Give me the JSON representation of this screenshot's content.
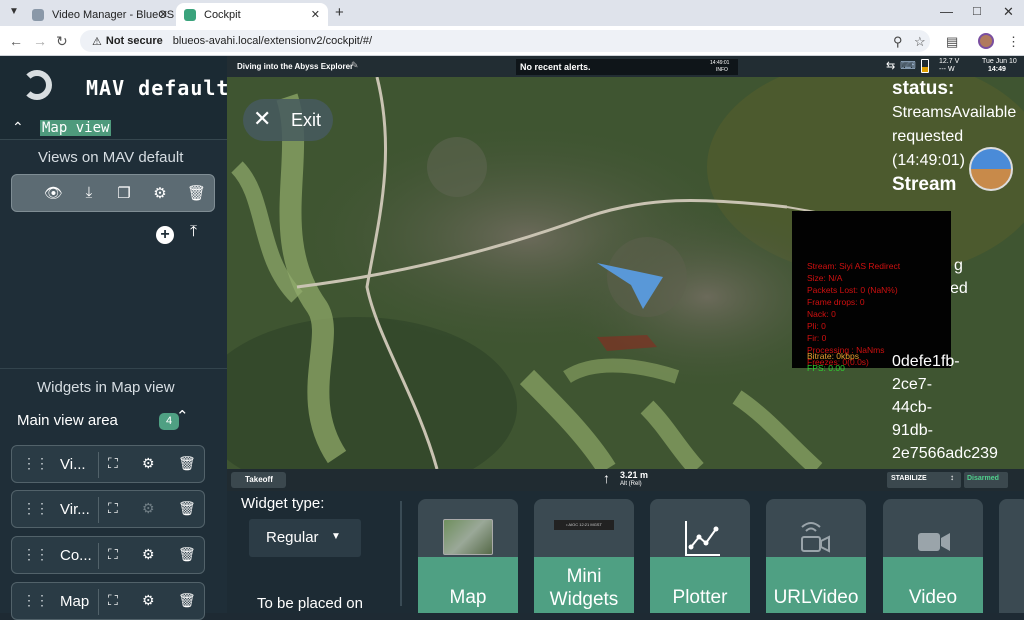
{
  "browser": {
    "tabs": [
      {
        "title": "Video Manager - BlueOS",
        "active": false
      },
      {
        "title": "Cockpit",
        "active": true
      }
    ],
    "not_secure_label": "Not secure",
    "url": "blueos-avahi.local/extensionv2/cockpit/#/"
  },
  "sidebar": {
    "app_title": "MAV default p",
    "current_view": "Map view",
    "views_title": "Views on MAV default",
    "widgets_title": "Widgets in Map view",
    "main_view_area_label": "Main view area",
    "main_view_area_count": "4",
    "widgets": [
      {
        "name": "Vi..."
      },
      {
        "name": "Vir..."
      },
      {
        "name": "Co..."
      },
      {
        "name": "Map"
      }
    ]
  },
  "topbar": {
    "mission_name": "Diving into the Abyss Explorer",
    "alerts": "No recent alerts.",
    "alert_time": "14:49:01",
    "alert_level": "INFO",
    "voltage": "12.7 V",
    "power": "--- W",
    "date": "Tue Jun 10",
    "time": "14:49"
  },
  "map": {
    "exit_label": "Exit",
    "status_lines": [
      "status:",
      "StreamsAvailable",
      "requested",
      "(14:49:01)",
      "Stream"
    ],
    "partial_lines": [
      "g",
      "ed"
    ],
    "stream_id_lines": [
      "0defe1fb-",
      "2ce7-",
      "44cb-",
      "91db-",
      "2e7566adc239"
    ],
    "stream_stats": [
      "Stream: Siyi AS Redirect",
      "Size: N/A",
      "Packets Lost: 0 (NaN%)",
      "Frame drops: 0",
      "Nack: 0",
      "Pli: 0",
      "Fir: 0",
      "Processing : NaNms",
      "Freezes: 0(0.0s)"
    ],
    "bitrate": "Bitrate: 0kbps",
    "fps": "FPS: 0.00"
  },
  "bottombar": {
    "takeoff_label": "Takeoff",
    "altitude_value": "3.21 m",
    "altitude_label": "Alt (Rel)",
    "mode": "STABILIZE",
    "arm_state": "Disarmed"
  },
  "edit_panel": {
    "widget_type_label": "Widget type:",
    "widget_type_value": "Regular",
    "placed_label": "To be placed on",
    "mini_widgets_strip": "• AIOC 12:21 MGST",
    "widget_tiles": [
      "Map",
      "Mini Widgets",
      "Plotter",
      "URLVideo",
      "Video"
    ]
  },
  "colors": {
    "accent_green": "#4fa083",
    "sidebar_bg": "#1f2e38",
    "panel_bg": "#1d2b34",
    "vehicle_arrow": "#5a9be0",
    "stats_red": "#d01010",
    "bitrate_orange": "#e8a030",
    "fps_green": "#30d030"
  }
}
